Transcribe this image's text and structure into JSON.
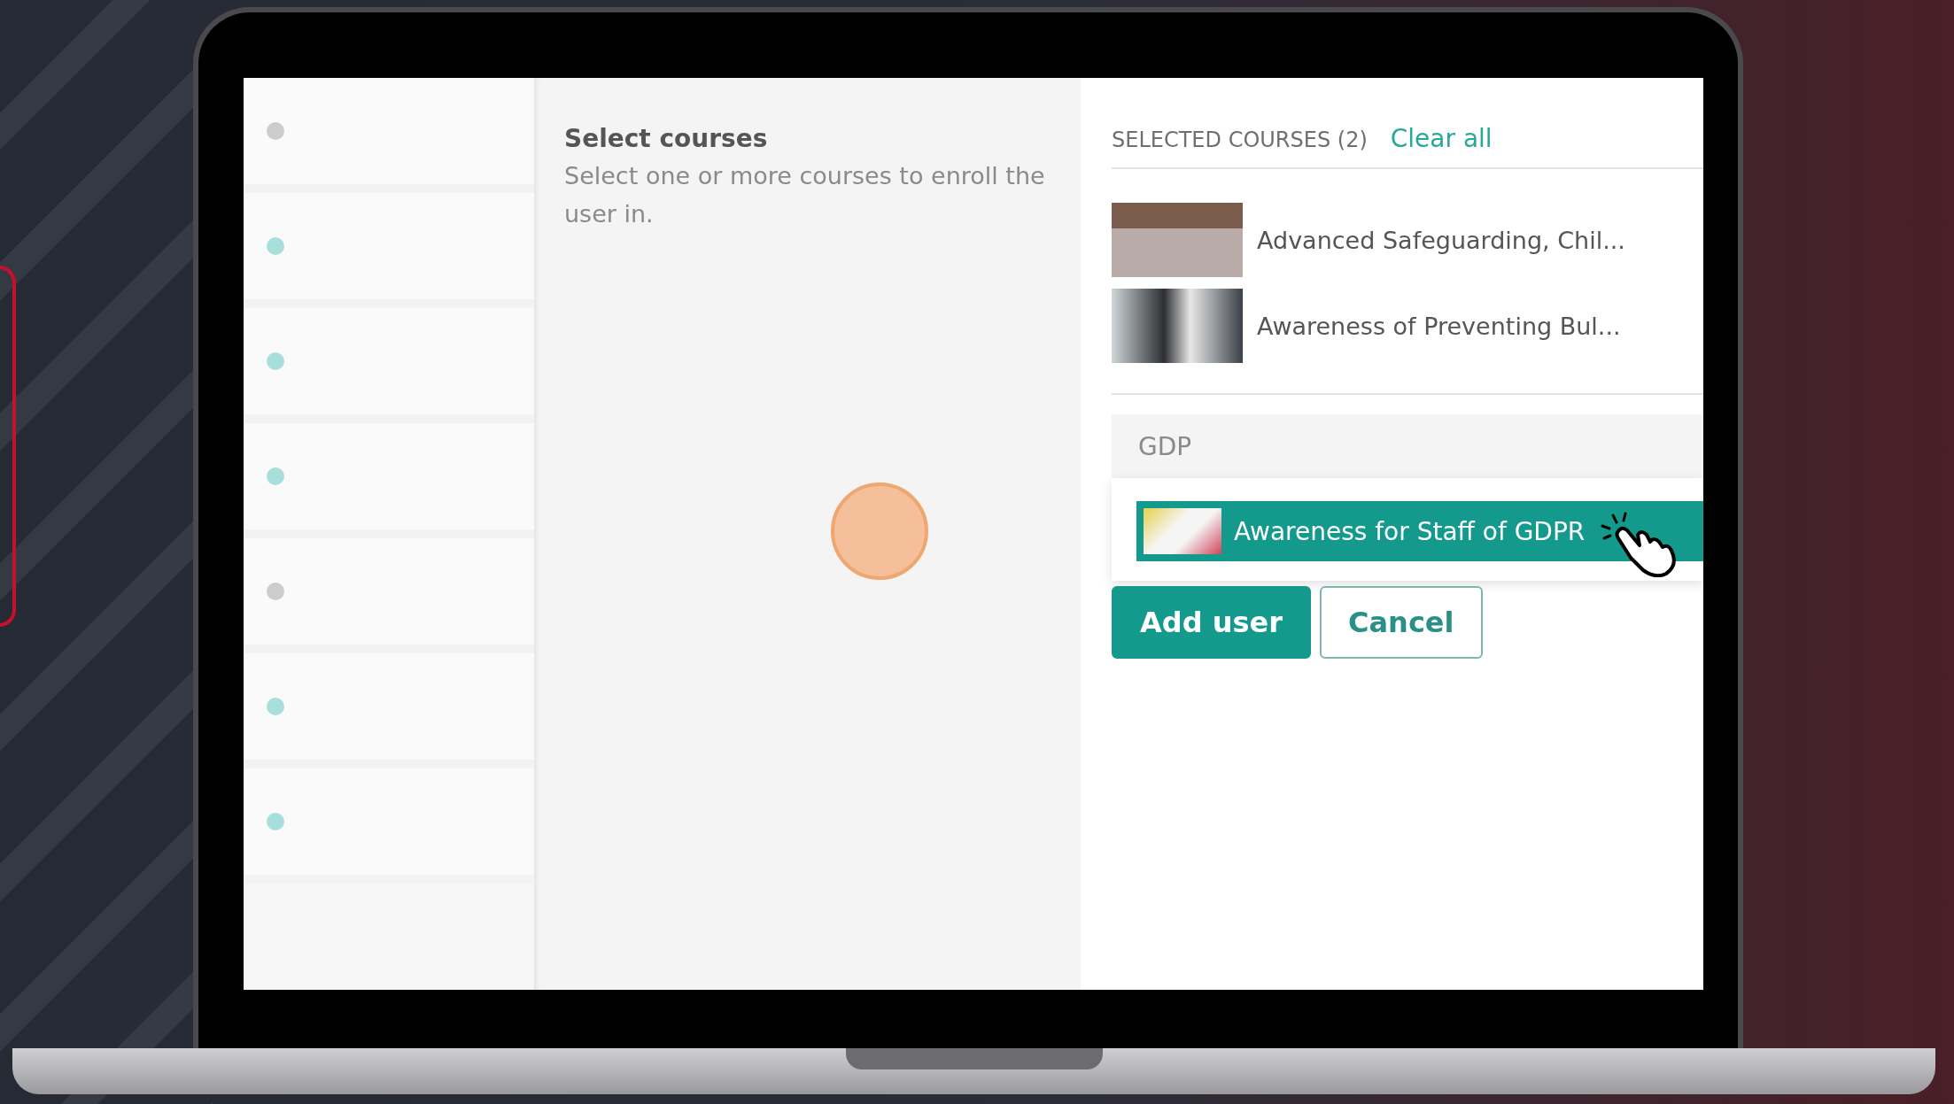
{
  "user_list": {
    "rows": [
      {
        "color": "#cccccc"
      },
      {
        "color": "#a8dfdc"
      },
      {
        "color": "#a8dfdc"
      },
      {
        "color": "#a8dfdc"
      },
      {
        "color": "#cccccc"
      },
      {
        "color": "#a8dfdc"
      },
      {
        "color": "#a8dfdc"
      }
    ]
  },
  "course_select": {
    "title": "Select courses",
    "description": "Select one or more courses to enroll the user in."
  },
  "selected_courses": {
    "heading": "SELECTED COURSES (2)",
    "clear_link": "Clear all",
    "items": [
      {
        "title": "Advanced Safeguarding, Chil..."
      },
      {
        "title": "Awareness of Preventing Bul..."
      }
    ]
  },
  "search": {
    "value": "GDP"
  },
  "suggestions": [
    {
      "title": "Awareness for Staff of GDPR",
      "selected": true
    }
  ],
  "buttons": [
    {
      "label": "Add user",
      "kind": "primary"
    },
    {
      "label": "Cancel",
      "kind": "secondary"
    }
  ]
}
